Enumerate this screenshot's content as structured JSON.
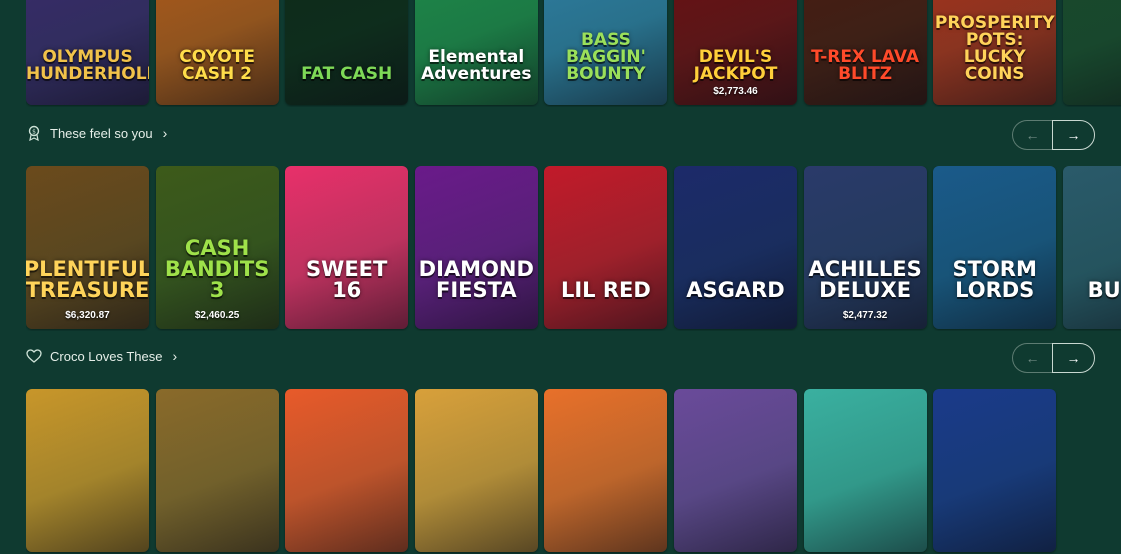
{
  "top_row": [
    {
      "title": "OLYMPUS THUNDERHOLD",
      "bg": "#3a2a6b",
      "accent": "#f1c24a",
      "jackpot": ""
    },
    {
      "title": "COYOTE CASH 2",
      "bg": "#b05a1a",
      "accent": "#ffdd4a",
      "jackpot": ""
    },
    {
      "title": "FAT CASH",
      "bg": "#0e2a18",
      "accent": "#7ed957",
      "jackpot": ""
    },
    {
      "title": "Elemental Adventures",
      "bg": "#1f8a4a",
      "accent": "#ffffff",
      "jackpot": ""
    },
    {
      "title": "BASS BAGGIN' BOUNTY",
      "bg": "#2f7ea2",
      "accent": "#9be05a",
      "jackpot": ""
    },
    {
      "title": "DEVIL'S JACKPOT",
      "bg": "#6d0e12",
      "accent": "#ffcf3a",
      "jackpot": "$2,773.46"
    },
    {
      "title": "T-REX LAVA BLITZ",
      "bg": "#4a1a10",
      "accent": "#ff4a2a",
      "jackpot": ""
    },
    {
      "title": "PROSPERITY POTS: LUCKY COINS",
      "bg": "#a8321c",
      "accent": "#ffd35a",
      "jackpot": ""
    },
    {
      "title": "",
      "bg": "#1a4a2c",
      "accent": "#f0c24a",
      "jackpot": ""
    }
  ],
  "sections": {
    "first": {
      "title": "These feel so you",
      "icon": "award-icon"
    },
    "second": {
      "title": "Croco Loves These",
      "icon": "heart-icon"
    }
  },
  "mid_row": [
    {
      "title": "PLENTIFUL TREASURE",
      "bg": "#6b4a1c",
      "accent": "#ffd45a",
      "jackpot": "$6,320.87"
    },
    {
      "title": "CASH BANDITS 3",
      "bg": "#3d5a1a",
      "accent": "#9fe14a",
      "jackpot": "$2,460.25"
    },
    {
      "title": "SWEET 16",
      "bg": "#e8306a",
      "accent": "#ffffff",
      "jackpot": ""
    },
    {
      "title": "DIAMOND FIESTA",
      "bg": "#6a1a8a",
      "accent": "#ffffff",
      "jackpot": ""
    },
    {
      "title": "LIL RED",
      "bg": "#c21a2a",
      "accent": "#ffffff",
      "jackpot": ""
    },
    {
      "title": "ASGARD",
      "bg": "#1c2a6a",
      "accent": "#ffffff",
      "jackpot": ""
    },
    {
      "title": "ACHILLES DELUXE",
      "bg": "#2a3a6a",
      "accent": "#ffffff",
      "jackpot": "$2,477.32"
    },
    {
      "title": "STORM LORDS",
      "bg": "#1a5a8a",
      "accent": "#ffffff",
      "jackpot": ""
    },
    {
      "title": "BU BU",
      "bg": "#2a5a6a",
      "accent": "#ffffff",
      "jackpot": ""
    }
  ],
  "bot_row": [
    {
      "bg": "#c8962a"
    },
    {
      "bg": "#8a6a2a"
    },
    {
      "bg": "#e85a2a"
    },
    {
      "bg": "#d8a03a"
    },
    {
      "bg": "#e8702a"
    },
    {
      "bg": "#6a4a9a"
    },
    {
      "bg": "#3ab0a0"
    },
    {
      "bg": "#1a3a8a"
    }
  ],
  "nav": {
    "prev_symbol": "←",
    "next_symbol": "→"
  }
}
